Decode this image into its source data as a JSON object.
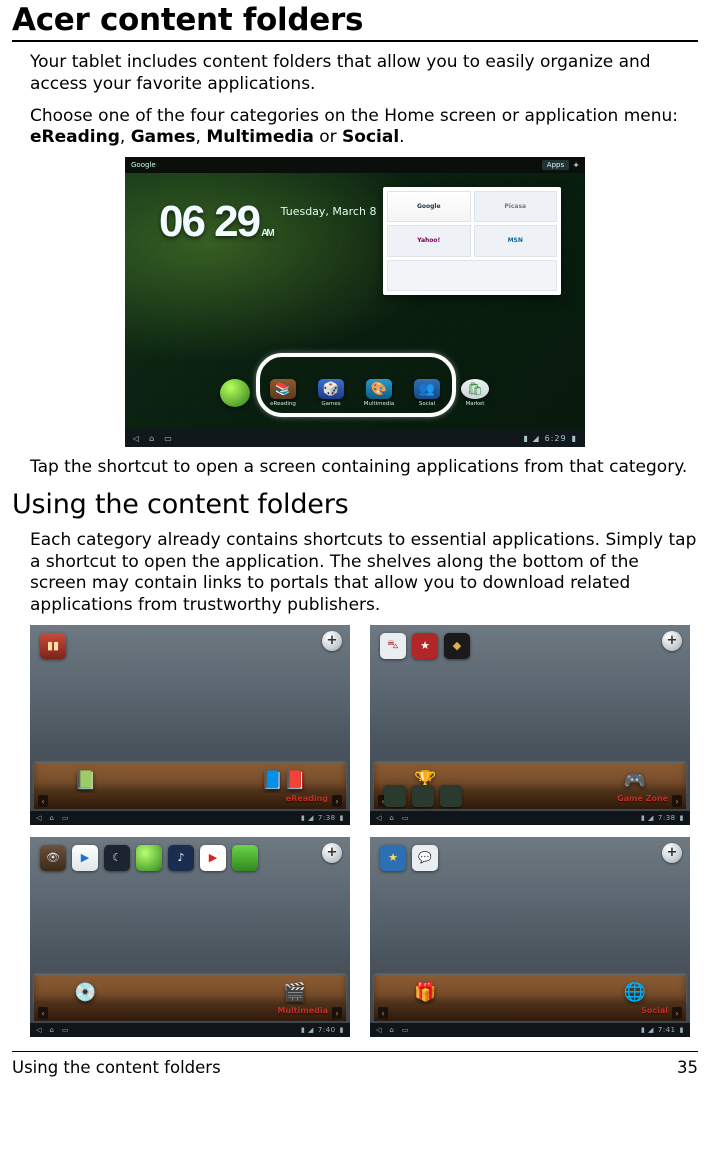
{
  "title": "Acer content folders",
  "intro_p1": "Your tablet includes content folders that allow you to easily organize and access your favorite applications.",
  "intro_p2_lead": "Choose one of the four categories on the Home screen or application menu: ",
  "categories_bold": [
    "eReading",
    "Games",
    "Multimedia",
    "Social"
  ],
  "or_word": " or ",
  "period": ".",
  "after_hero": "Tap the shortcut to open a screen containing applications from that category.",
  "subsection": "Using the content folders",
  "sub_p": "Each category already contains shortcuts to essential applications. Simply tap a shortcut to open the application. The shelves along the bottom of the screen may contain links to portals that allow you to download related applications from trustworthy publishers.",
  "hero": {
    "google_label": "Google",
    "apps_label": "Apps",
    "clock": "06 29",
    "ampm": "AM",
    "date": "Tuesday, March 8",
    "thumbs": [
      "Google",
      "Picasa",
      "Yahoo!",
      "MSN"
    ],
    "dock": [
      {
        "label": "eReading"
      },
      {
        "label": "Games"
      },
      {
        "label": "Multimedia"
      },
      {
        "label": "Social"
      }
    ],
    "market_label": "Market",
    "nav_time": "6:29"
  },
  "panels": [
    {
      "key": "ereading",
      "label": "eReading",
      "clock": "7:38",
      "topIcons": [
        "books"
      ],
      "shelfLeft": "📗",
      "shelfRight": "📘📕"
    },
    {
      "key": "games",
      "label": "Game Zone",
      "clock": "7:38",
      "topIcons": [
        "car",
        "hero",
        "blk"
      ],
      "shelfLeft": "🏆",
      "shelfRight": "🎮",
      "bottomMinis": [
        "droid",
        "nv",
        "pad"
      ]
    },
    {
      "key": "multimedia",
      "label": "Multimedia",
      "clock": "7:40",
      "topIcons": [
        "eye",
        "play",
        "dark",
        "green",
        "note",
        "yt",
        "sq"
      ],
      "shelfLeft": "💿",
      "shelfRight": "🎬"
    },
    {
      "key": "social",
      "label": "Social",
      "clock": "7:41",
      "topIcons": [
        "star",
        "chat"
      ],
      "shelfLeft": "🎁",
      "shelfRight": "🌐"
    }
  ],
  "footer_left": "Using the content folders",
  "footer_right": "35"
}
